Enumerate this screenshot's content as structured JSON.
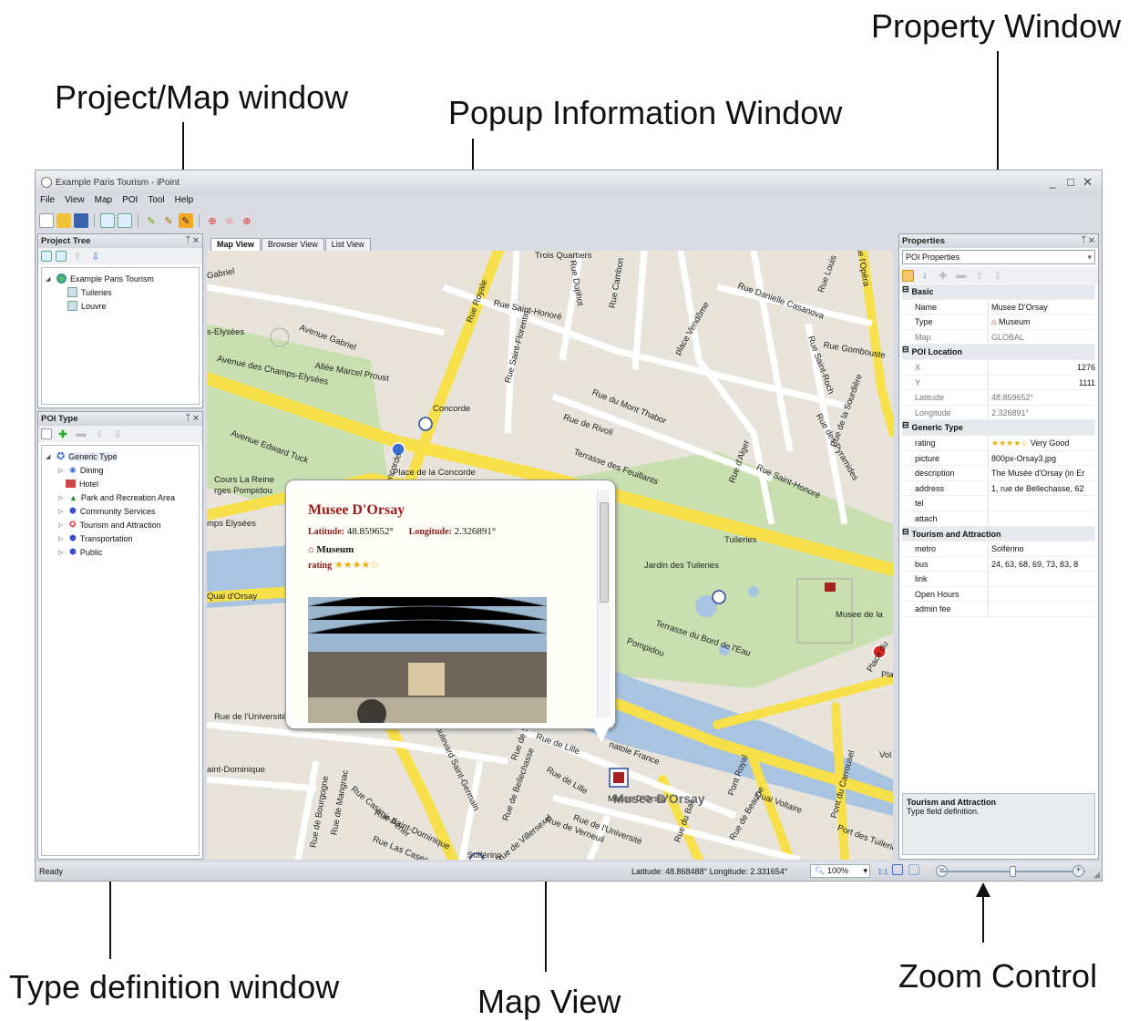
{
  "annotations": {
    "property_window": "Property Window",
    "project_map_window": "Project/Map window",
    "popup_information_window": "Popup Information Window",
    "type_definition_window": "Type definition window",
    "map_view": "Map View",
    "zoom_control": "Zoom Control"
  },
  "window": {
    "title": "Example Paris Tourism - iPoint",
    "minimize": "_",
    "maximize": "□",
    "close": "✕"
  },
  "menu": [
    "File",
    "View",
    "Map",
    "POI",
    "Tool",
    "Help"
  ],
  "project_tree": {
    "header": "Project Tree",
    "root": "Example Paris Tourism",
    "children": [
      "Tuileries",
      "Louvre"
    ]
  },
  "poi_type": {
    "header": "POI Type",
    "root": "Generic Type",
    "items": [
      "Dining",
      "Hotel",
      "Park and Recreation Area",
      "Community Services",
      "Tourism and Attraction",
      "Transportation",
      "Public"
    ]
  },
  "tabs": [
    "Map View",
    "Browser View",
    "List View"
  ],
  "map": {
    "streets": [
      "Gabriel",
      "Avenue Gabriel",
      "s-Elysées",
      "Allée Marcel Proust",
      "Avenue des Champs-Elysées",
      "Place de la Concorde",
      "Concorde",
      "Place de la Concorde",
      "Rue Royale",
      "Rue Saint-Honoré",
      "Rue Saint-Florentin",
      "Rue Duphot",
      "Rue Cambon",
      "Rue de Rivoli",
      "Terrasse des Feuillants",
      "Rue du Mont Thabor",
      "Tuileries",
      "Jardin des Tuileries",
      "Rue Danielle Casanova",
      "Rue Gombouste",
      "place Vendôme",
      "Rue Saint-Roch",
      "Rue des Pyramides",
      "Cours La Reine",
      "rges Pompidou",
      "mps Elysées",
      "Quai d'Orsay",
      "Rue de l'Université",
      "aint-Dominique",
      "Rue de Bourgogne",
      "Rue de Lille",
      "Rue de Bellechasse",
      "Boulevard Saint-Germain",
      "Rue de Solférino",
      "Rue Saint-Dominique",
      "Rue Las Cases",
      "Rue de Verneuil",
      "Rue du Bac",
      "Pont Royal",
      "Quai Voltaire",
      "Pont du Carrousel",
      "Port des Tuileries",
      "Terrasse du Bord de l'Eau",
      "Rue Saint-Honoré",
      "Rue d'Alger",
      "Musee de la",
      "Place du",
      "Pla",
      "Vol",
      "Solférino",
      "Musee D'Orsay",
      "natole France",
      "Rue de la Sourdière",
      "Rue Louis",
      "de l'Opéra",
      "Trois Quartiers",
      "Pompidou",
      "Avenue Edward Tuck",
      "Rue de Mangnac",
      "Rue Casimir-Périer",
      "Rue de Villersexel",
      "Rue de l'Université",
      "Rue de Beaune",
      "Rue de Lille"
    ]
  },
  "popup": {
    "title": "Musee D'Orsay",
    "lat_label": "Latitude:",
    "lat_value": "48.859652°",
    "lon_label": "Longitude:",
    "lon_value": "2.326891°",
    "type": "Museum",
    "rating_label": "rating",
    "rating_stars": 4,
    "rating_max": 5
  },
  "properties": {
    "header": "Properties",
    "combo": "POI Properties",
    "categories": [
      {
        "name": "Basic",
        "rows": [
          {
            "key": "Name",
            "value": "Musee D'Orsay"
          },
          {
            "key": "Type",
            "value": "Museum"
          },
          {
            "key": "Map",
            "value": "GLOBAL"
          }
        ]
      },
      {
        "name": "POI Location",
        "rows": [
          {
            "key": "X",
            "value": "1276"
          },
          {
            "key": "Y",
            "value": "1111"
          },
          {
            "key": "Latitude",
            "value": "48.859652°"
          },
          {
            "key": "Longitude",
            "value": "2.326891°"
          }
        ]
      },
      {
        "name": "Generic Type",
        "rows": [
          {
            "key": "rating",
            "value": "Very Good"
          },
          {
            "key": "picture",
            "value": "800px-Orsay3.jpg"
          },
          {
            "key": "description",
            "value": "The Musée d'Orsay (in Er"
          },
          {
            "key": "address",
            "value": "1, rue de Bellechasse, 62"
          },
          {
            "key": "tel",
            "value": ""
          },
          {
            "key": "attach",
            "value": ""
          }
        ]
      },
      {
        "name": "Tourism and Attraction",
        "rows": [
          {
            "key": "metro",
            "value": "Solférino"
          },
          {
            "key": "bus",
            "value": "24, 63, 68, 69, 73, 83, 8"
          },
          {
            "key": "link",
            "value": ""
          },
          {
            "key": "Open Hours",
            "value": ""
          },
          {
            "key": "admin fee",
            "value": ""
          }
        ]
      }
    ],
    "desc_title": "Tourism and Attraction",
    "desc_text": "Type field definition."
  },
  "status": {
    "ready": "Ready",
    "coords": "Latitude: 48.868488° Longitude: 2.331654°",
    "zoom": "100%",
    "slider_level": 0.5
  },
  "colors": {
    "road_yellow": "#f7e04a",
    "road_white": "#ffffff",
    "park": "#c9dfb0",
    "water": "#a8c4e0",
    "block": "#e8e4dc",
    "popup_title": "#9b1c1c"
  }
}
